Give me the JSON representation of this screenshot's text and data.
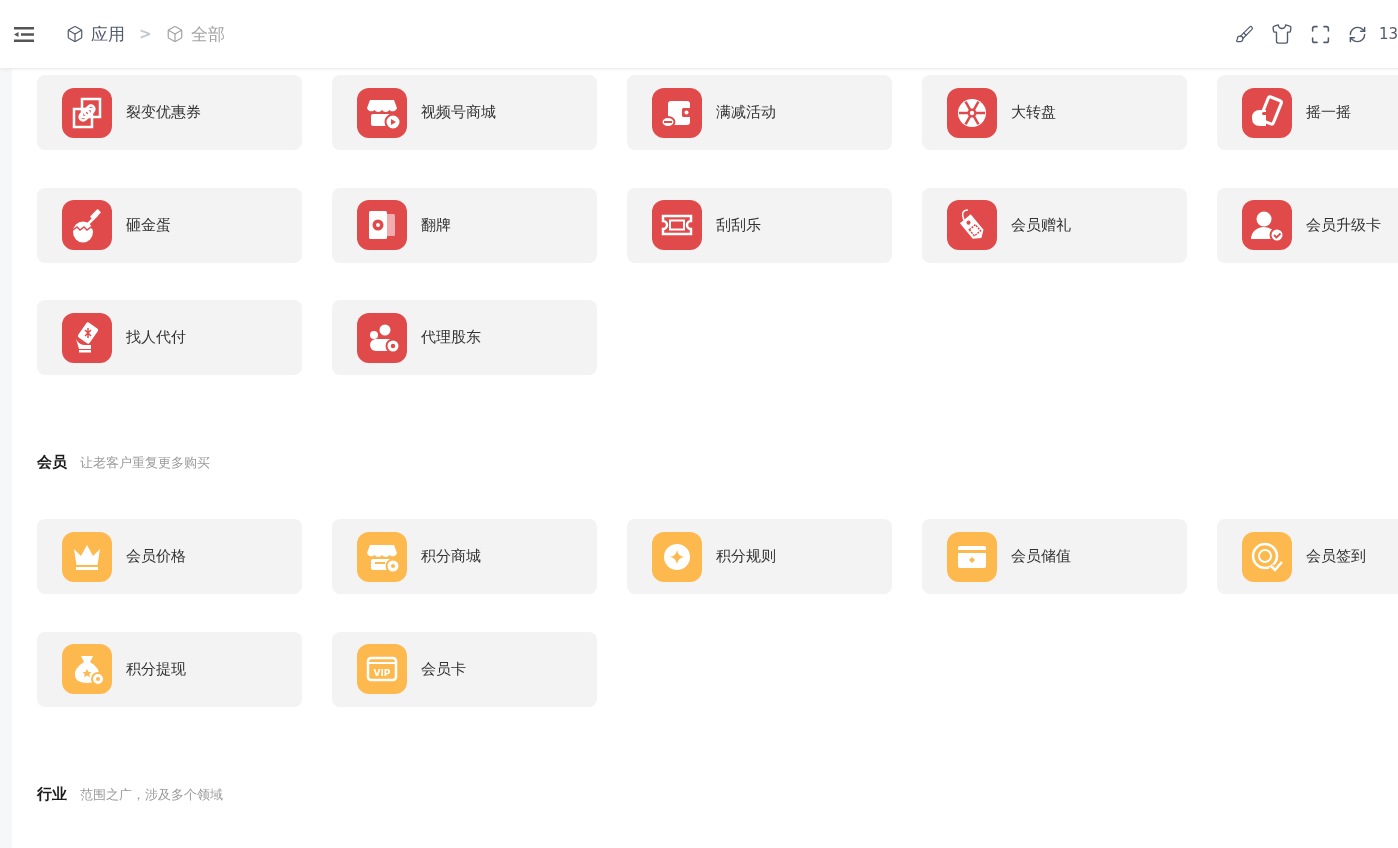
{
  "header": {
    "breadcrumb": [
      {
        "label": "应用",
        "current": false
      },
      {
        "label": "全部",
        "current": true
      }
    ],
    "separator": ">",
    "trailing_text": "13"
  },
  "sections": [
    {
      "color": "#e04a4a",
      "apps": [
        {
          "label": "裂变优惠券"
        },
        {
          "label": "视频号商城"
        },
        {
          "label": "满减活动"
        },
        {
          "label": "大转盘"
        },
        {
          "label": "摇一摇"
        },
        {
          "label": "砸金蛋"
        },
        {
          "label": "翻牌"
        },
        {
          "label": "刮刮乐"
        },
        {
          "label": "会员赠礼"
        },
        {
          "label": "会员升级卡"
        },
        {
          "label": "找人代付"
        },
        {
          "label": "代理股东"
        }
      ]
    },
    {
      "title": "会员",
      "subtitle": "让老客户重复更多购买",
      "color": "#fdb94e",
      "apps": [
        {
          "label": "会员价格"
        },
        {
          "label": "积分商城"
        },
        {
          "label": "积分规则"
        },
        {
          "label": "会员储值"
        },
        {
          "label": "会员签到"
        },
        {
          "label": "积分提现"
        },
        {
          "label": "会员卡",
          "icon_text": "VIP"
        }
      ]
    },
    {
      "title": "行业",
      "subtitle": "范围之广，涉及多个领域"
    }
  ]
}
